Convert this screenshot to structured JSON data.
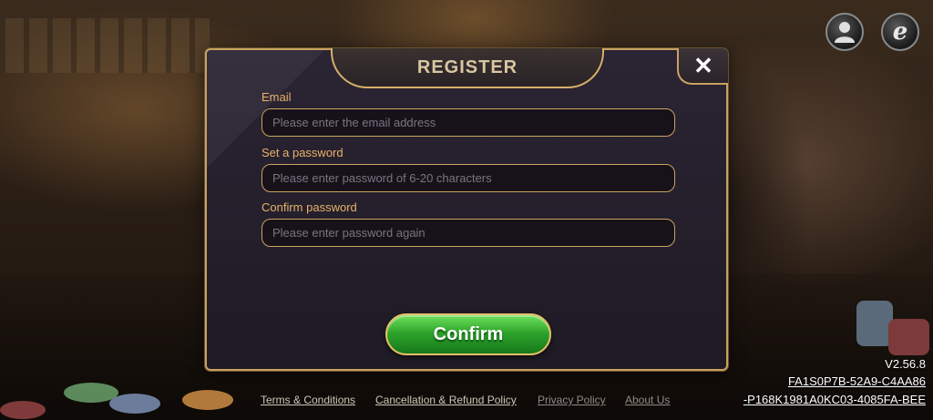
{
  "top_icons": {
    "user_icon": "user-icon",
    "e_icon": "e-browser-icon",
    "e_glyph": "e"
  },
  "dialog": {
    "title": "REGISTER",
    "close_glyph": "✕",
    "fields": [
      {
        "label": "Email",
        "placeholder": "Please enter the email address",
        "value": ""
      },
      {
        "label": "Set a password",
        "placeholder": "Please enter password of 6-20 characters",
        "value": ""
      },
      {
        "label": "Confirm password",
        "placeholder": "Please enter password again",
        "value": ""
      }
    ],
    "confirm_label": "Confirm"
  },
  "footer": {
    "links": [
      "Terms & Conditions",
      "Cancellation & Refund Policy",
      "Privacy Policy",
      "About Us"
    ]
  },
  "build": {
    "version": "V2.56.8",
    "id_line1": "FA1S0P7B-52A9-C4AA86",
    "id_line2": "-P168K1981A0KC03-4085FA-BEE"
  },
  "colors": {
    "gold_border": "#c9a25e",
    "label_orange": "#e9b16a",
    "confirm_green": "#2fa52c"
  }
}
